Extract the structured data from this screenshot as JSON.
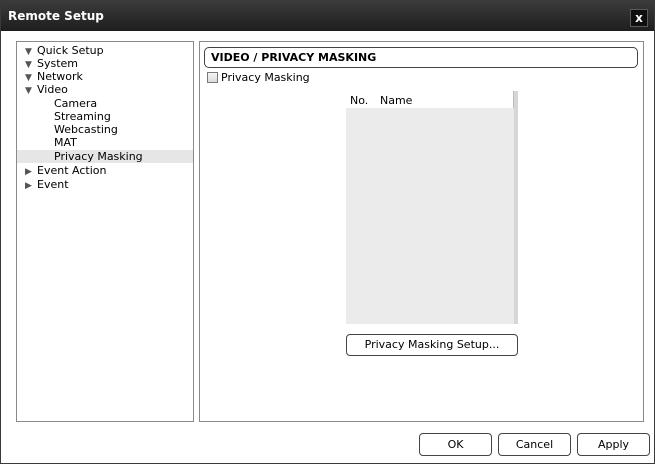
{
  "window": {
    "title": "Remote Setup",
    "close_symbol": "x"
  },
  "tree": {
    "items": [
      {
        "label": "Quick Setup",
        "arrow": "▼"
      },
      {
        "label": "System",
        "arrow": "▼"
      },
      {
        "label": "Network",
        "arrow": "▼"
      },
      {
        "label": "Video",
        "arrow": "▼"
      },
      {
        "label": "Camera"
      },
      {
        "label": "Streaming"
      },
      {
        "label": "Webcasting"
      },
      {
        "label": "MAT"
      },
      {
        "label": "Privacy Masking",
        "selected": true
      },
      {
        "label": "Event Action",
        "arrow": "▶"
      },
      {
        "label": "Event",
        "arrow": "▶"
      }
    ]
  },
  "content": {
    "header": "VIDEO / PRIVACY MASKING",
    "checkbox_label": "Privacy Masking",
    "list_columns": [
      "No.",
      "Name"
    ],
    "setup_button": "Privacy Masking Setup..."
  },
  "footer": {
    "ok": "OK",
    "cancel": "Cancel",
    "apply": "Apply"
  }
}
